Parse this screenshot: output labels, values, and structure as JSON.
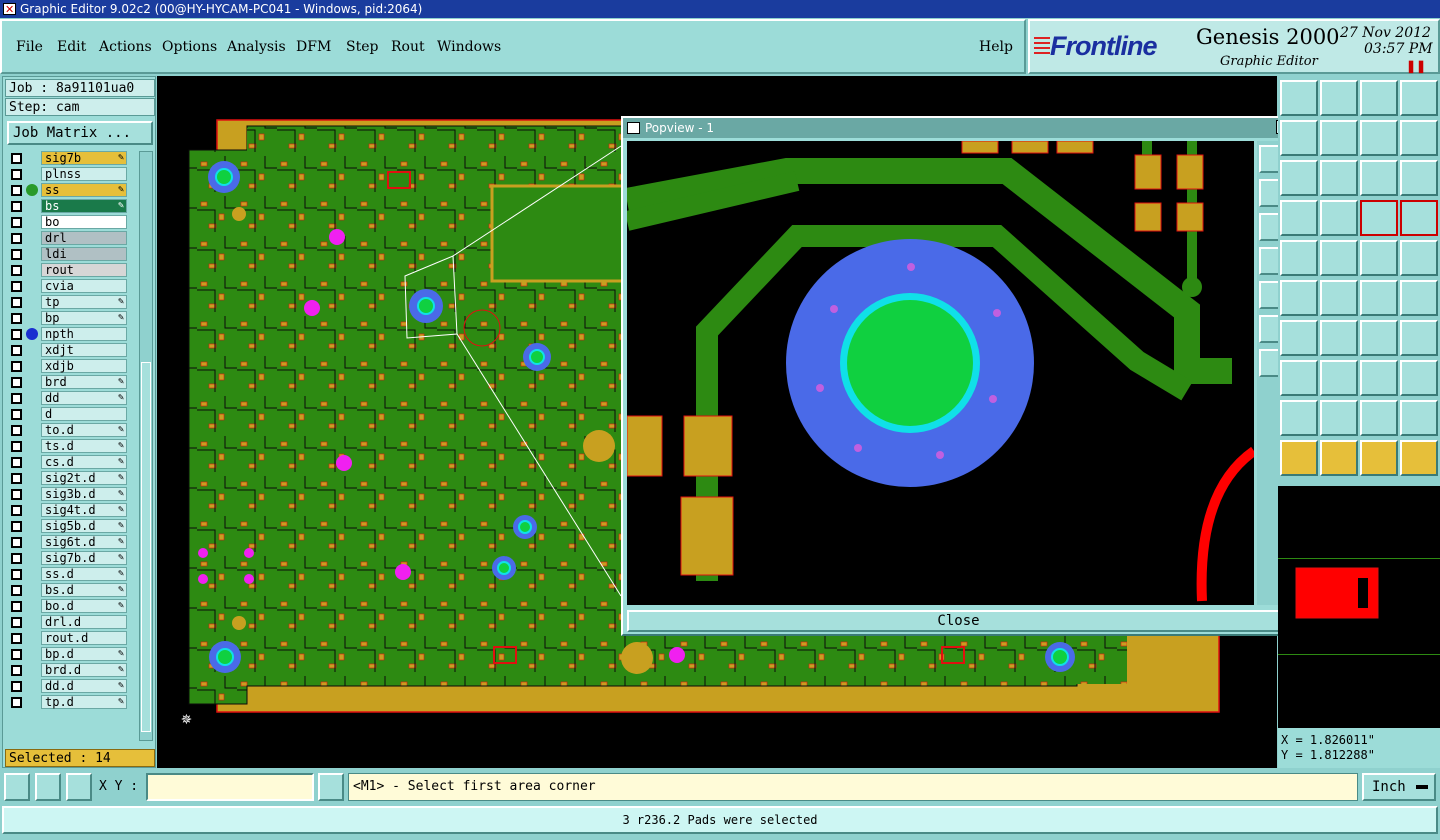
{
  "window": {
    "title": "Graphic Editor 9.02c2 (00@HY-HYCAM-PC041 - Windows, pid:2064)"
  },
  "menu": {
    "items": [
      "File",
      "Edit",
      "Actions",
      "Options",
      "Analysis",
      "DFM",
      "Step",
      "Rout",
      "Windows"
    ],
    "help": "Help"
  },
  "brand": {
    "logo": "Frontline",
    "product": "Genesis 2000",
    "subtitle": "Graphic Editor",
    "date": "27 Nov 2012",
    "time": "03:57 PM"
  },
  "job": {
    "job_label": "Job : 8a91101ua0",
    "step_label": "Step: cam",
    "matrix_button": "Job Matrix ..."
  },
  "layers": [
    {
      "name": "sig7b",
      "color": "#e6bf3a",
      "edit": true
    },
    {
      "name": "plnss",
      "color": "#cdeeec",
      "edit": false
    },
    {
      "name": "ss",
      "color": "#e6bf3a",
      "edit": true,
      "indicator": "#2a9a2a"
    },
    {
      "name": "bs",
      "color": "#1a7a4a",
      "edit": true,
      "active": true
    },
    {
      "name": "bo",
      "color": "#ffffff",
      "edit": false
    },
    {
      "name": "drl",
      "color": "#b0c0c4",
      "edit": false
    },
    {
      "name": "ldi",
      "color": "#b0c0c4",
      "edit": false
    },
    {
      "name": "rout",
      "color": "#d6d6d6",
      "edit": false
    },
    {
      "name": "cvia",
      "color": "#cdeeec",
      "edit": false
    },
    {
      "name": "tp",
      "color": "#cdeeec",
      "edit": true
    },
    {
      "name": "bp",
      "color": "#cdeeec",
      "edit": true
    },
    {
      "name": "npth",
      "color": "#cdeeec",
      "edit": false,
      "indicator": "#1a2fd0"
    },
    {
      "name": "xdjt",
      "color": "#cdeeec",
      "edit": false
    },
    {
      "name": "xdjb",
      "color": "#cdeeec",
      "edit": false
    },
    {
      "name": "brd",
      "color": "#cdeeec",
      "edit": true
    },
    {
      "name": "dd",
      "color": "#cdeeec",
      "edit": true
    },
    {
      "name": "d",
      "color": "#cdeeec",
      "edit": false
    },
    {
      "name": "to.d",
      "color": "#cdeeec",
      "edit": true
    },
    {
      "name": "ts.d",
      "color": "#cdeeec",
      "edit": true
    },
    {
      "name": "cs.d",
      "color": "#cdeeec",
      "edit": true
    },
    {
      "name": "sig2t.d",
      "color": "#cdeeec",
      "edit": true
    },
    {
      "name": "sig3b.d",
      "color": "#cdeeec",
      "edit": true
    },
    {
      "name": "sig4t.d",
      "color": "#cdeeec",
      "edit": true
    },
    {
      "name": "sig5b.d",
      "color": "#cdeeec",
      "edit": true
    },
    {
      "name": "sig6t.d",
      "color": "#cdeeec",
      "edit": true
    },
    {
      "name": "sig7b.d",
      "color": "#cdeeec",
      "edit": true
    },
    {
      "name": "ss.d",
      "color": "#cdeeec",
      "edit": true
    },
    {
      "name": "bs.d",
      "color": "#cdeeec",
      "edit": true
    },
    {
      "name": "bo.d",
      "color": "#cdeeec",
      "edit": true
    },
    {
      "name": "drl.d",
      "color": "#cdeeec",
      "edit": false
    },
    {
      "name": "rout.d",
      "color": "#cdeeec",
      "edit": false
    },
    {
      "name": "bp.d",
      "color": "#cdeeec",
      "edit": true
    },
    {
      "name": "brd.d",
      "color": "#cdeeec",
      "edit": true
    },
    {
      "name": "dd.d",
      "color": "#cdeeec",
      "edit": true
    },
    {
      "name": "tp.d",
      "color": "#cdeeec",
      "edit": true
    }
  ],
  "selected": "Selected : 14",
  "popview": {
    "title": "Popview - 1",
    "close_label": "Close"
  },
  "coords": {
    "x": "X = 1.826011\"",
    "y": "Y = 1.812288\""
  },
  "command": {
    "xy_label": "X Y :",
    "xy_value": "",
    "prompt": "<M1> - Select first area corner",
    "units": "Inch"
  },
  "status": "3 r236.2 Pads were selected",
  "colors": {
    "copper": "#c8a020",
    "board": "#2d8a12",
    "pad_outline": "#e01010",
    "via": "#4a6ae8",
    "drill": "#10d040",
    "magenta": "#f020f0",
    "cyan": "#10e0e8"
  }
}
